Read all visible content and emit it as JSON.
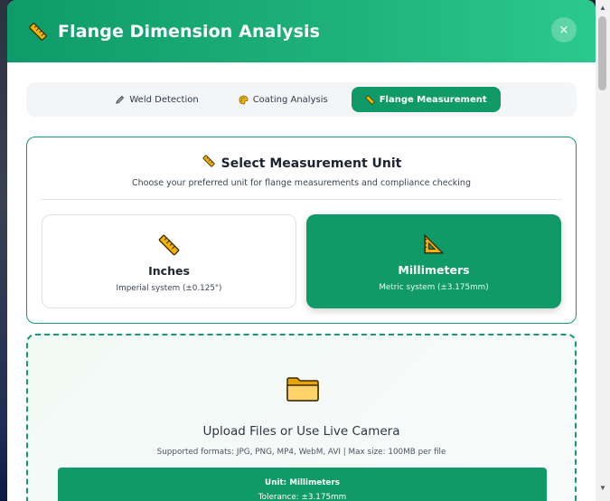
{
  "modal": {
    "title": "Flange Dimension Analysis",
    "close_label": "×",
    "icon": "ruler-icon"
  },
  "tabs": [
    {
      "label": "Weld Detection",
      "icon": "pen-icon",
      "active": false
    },
    {
      "label": "Coating Analysis",
      "icon": "palette-icon",
      "active": false
    },
    {
      "label": "Flange Measurement",
      "icon": "ruler-icon",
      "active": true
    }
  ],
  "unit_select": {
    "title": "Select Measurement Unit",
    "subtitle": "Choose your preferred unit for flange measurements and compliance checking",
    "options": [
      {
        "name": "Inches",
        "desc": "Imperial system (±0.125\")",
        "icon": "ruler-icon",
        "selected": false
      },
      {
        "name": "Millimeters",
        "desc": "Metric system (±3.175mm)",
        "icon": "triangle-ruler-icon",
        "selected": true
      }
    ]
  },
  "upload": {
    "icon": "folder-icon",
    "title": "Upload Files or Use Live Camera",
    "subtitle": "Supported formats: JPG, PNG, MP4, WebM, AVI | Max size: 100MB per file",
    "banner_unit": "Unit: Millimeters",
    "banner_tolerance": "Tolerance: ±3.175mm"
  },
  "colors": {
    "accent": "#0f9a68",
    "header_start": "#0e9b6a",
    "header_end": "#2bc98d"
  }
}
